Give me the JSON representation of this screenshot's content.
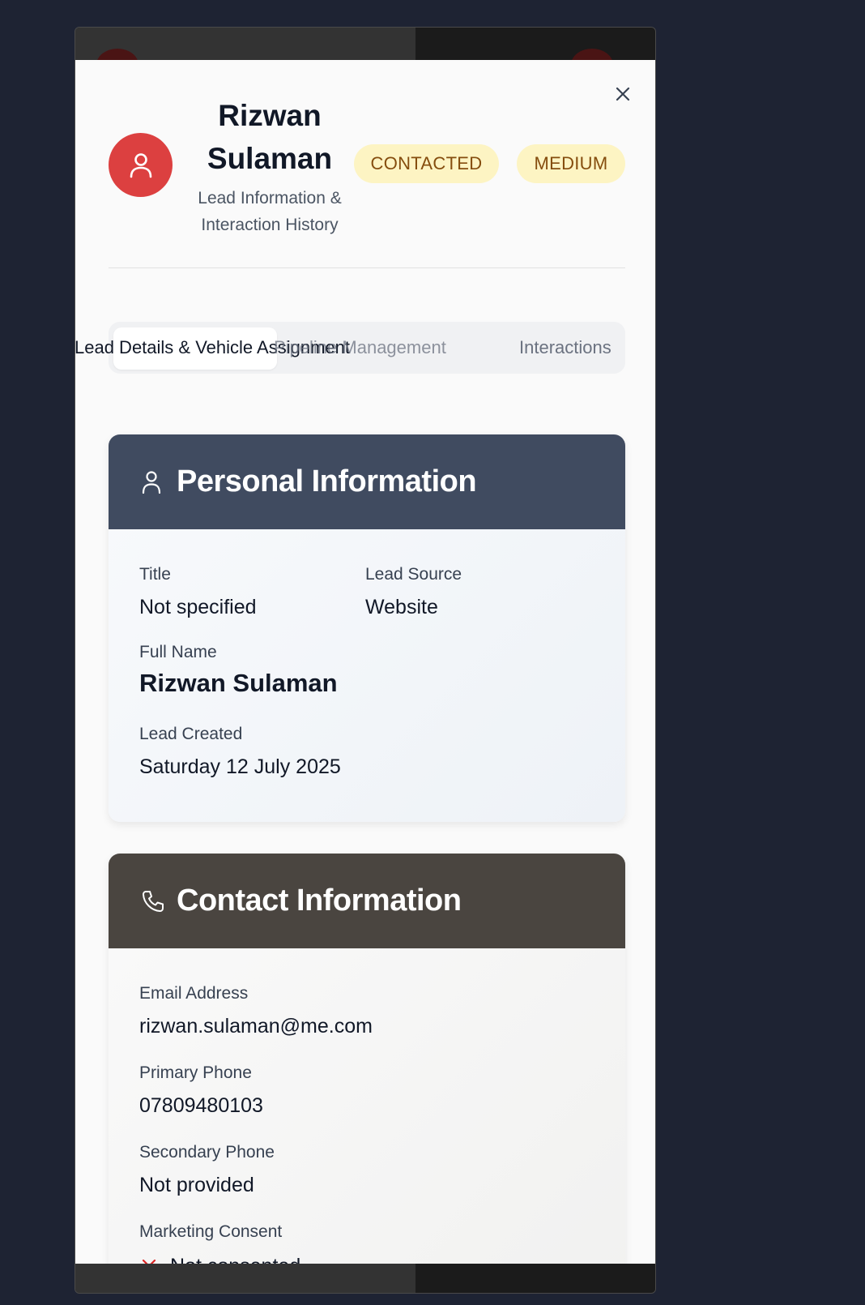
{
  "lead": {
    "name_line1": "Rizwan",
    "name_line2": "Sulaman",
    "subtitle_line1": "Lead Information &",
    "subtitle_line2": "Interaction History",
    "status_badge": "CONTACTED",
    "priority_badge": "MEDIUM"
  },
  "tabs": [
    {
      "label": "Lead Details & Vehicle Assignment",
      "active": true
    },
    {
      "label": "Pipeline Management",
      "active": false
    },
    {
      "label": "Interactions",
      "active": false
    }
  ],
  "personal": {
    "header": "Personal Information",
    "title_label": "Title",
    "title_value": "Not specified",
    "source_label": "Lead Source",
    "source_value": "Website",
    "fullname_label": "Full Name",
    "fullname_value": "Rizwan Sulaman",
    "created_label": "Lead Created",
    "created_value": "Saturday 12 July 2025"
  },
  "contact": {
    "header": "Contact Information",
    "email_label": "Email Address",
    "email_value": "rizwan.sulaman@me.com",
    "phone_label": "Primary Phone",
    "phone_value": "07809480103",
    "phone2_label": "Secondary Phone",
    "phone2_value": "Not provided",
    "consent_label": "Marketing Consent",
    "consent_value": "Not consented"
  },
  "icons": {
    "close": "close-icon",
    "avatar": "user-icon",
    "personal": "user-icon",
    "contact": "phone-icon",
    "consent": "x-icon"
  },
  "colors": {
    "avatar_bg": "#dc4040",
    "badge_bg": "#fdf4c3",
    "badge_text": "#854d0e",
    "personal_header": "#404b60",
    "contact_header": "#4a4540",
    "consent_x": "#dc2626"
  }
}
